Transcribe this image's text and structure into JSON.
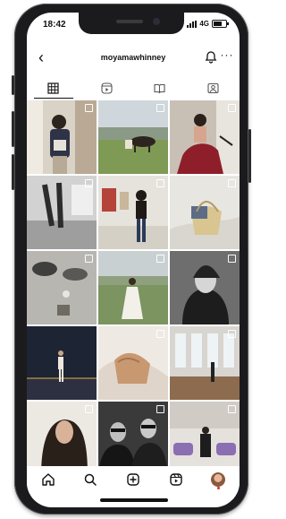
{
  "status": {
    "time": "18:42",
    "network": "4G"
  },
  "header": {
    "username": "moyamawhinney"
  },
  "tabs": [
    {
      "icon": "grid-icon",
      "active": true
    },
    {
      "icon": "reels-icon",
      "active": false
    },
    {
      "icon": "guides-icon",
      "active": false
    },
    {
      "icon": "tagged-icon",
      "active": false
    }
  ],
  "bottom_nav": [
    "home-icon",
    "search-icon",
    "new-post-icon",
    "reels-icon",
    "profile-avatar"
  ],
  "colors": {
    "accent": "#111111",
    "notification_dot": "#e02b2b",
    "phone_body": "#1b1b1d"
  }
}
